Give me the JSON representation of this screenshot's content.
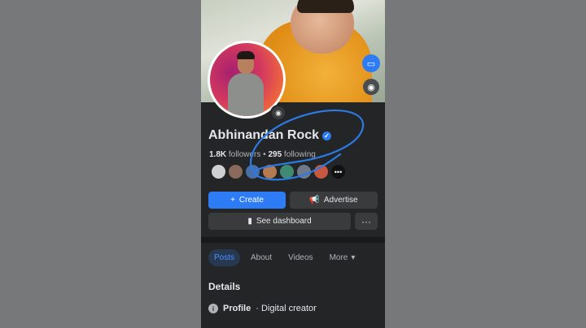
{
  "profile": {
    "name": "Abhinandan Rock",
    "followers_count": "1.8K",
    "followers_label": "followers",
    "following_count": "295",
    "following_label": "following",
    "separator": "•"
  },
  "buttons": {
    "create_icon": "+",
    "create_label": "Create",
    "advertise_label": "Advertise",
    "dashboard_label": "See dashboard",
    "more_label": "···"
  },
  "tabs": [
    {
      "label": "Posts",
      "active": true
    },
    {
      "label": "About",
      "active": false
    },
    {
      "label": "Videos",
      "active": false
    },
    {
      "label": "More",
      "active": false
    }
  ],
  "details": {
    "title": "Details",
    "profile_label": "Profile",
    "profile_value": "· Digital creator"
  },
  "colors": {
    "accent": "#2d7cf6",
    "background": "#242526",
    "annotation": "#2b7be5"
  },
  "icons": [
    "camera-icon",
    "verified-icon",
    "megaphone-icon",
    "chart-icon",
    "chevron-down-icon",
    "info-icon",
    "messenger-icon"
  ]
}
